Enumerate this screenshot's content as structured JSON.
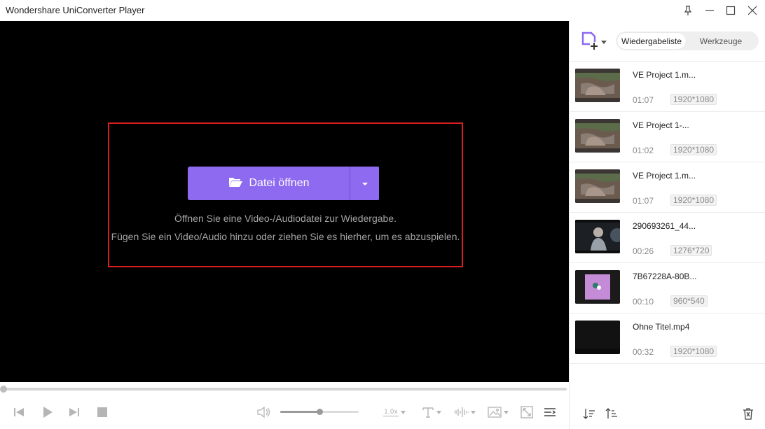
{
  "window": {
    "title": "Wondershare UniConverter Player",
    "controls": [
      "pin-icon",
      "minimize-icon",
      "maximize-icon",
      "close-icon"
    ]
  },
  "player": {
    "open_button_label": "Datei öffnen",
    "hint_line1": "Öffnen Sie eine Video-/Audiodatei zur Wiedergabe.",
    "hint_line2": "Fügen Sie ein Video/Audio hinzu oder ziehen Sie es hierher, um es abzuspielen.",
    "progress": 0,
    "volume": 0.5,
    "speed_label": "1.0x"
  },
  "sidebar": {
    "tabs": [
      {
        "label": "Wiedergabeliste",
        "active": true
      },
      {
        "label": "Werkzeuge",
        "active": false
      }
    ],
    "playlist": [
      {
        "name": "VE Project 1.m...",
        "duration": "01:07",
        "resolution": "1920*1080",
        "thumb": "forest"
      },
      {
        "name": "VE Project 1-...",
        "duration": "01:02",
        "resolution": "1920*1080",
        "thumb": "forest"
      },
      {
        "name": "VE Project 1.m...",
        "duration": "01:07",
        "resolution": "1920*1080",
        "thumb": "forest"
      },
      {
        "name": "290693261_44...",
        "duration": "00:26",
        "resolution": "1276*720",
        "thumb": "dark-figure"
      },
      {
        "name": "7B67228A-80B...",
        "duration": "00:10",
        "resolution": "960*540",
        "thumb": "purple"
      },
      {
        "name": "Ohne Titel.mp4",
        "duration": "00:32",
        "resolution": "1920*1080",
        "thumb": "black"
      }
    ]
  },
  "colors": {
    "accent": "#8e6af0",
    "drop_zone_border": "#d81e1e",
    "video_bg": "#000000"
  }
}
